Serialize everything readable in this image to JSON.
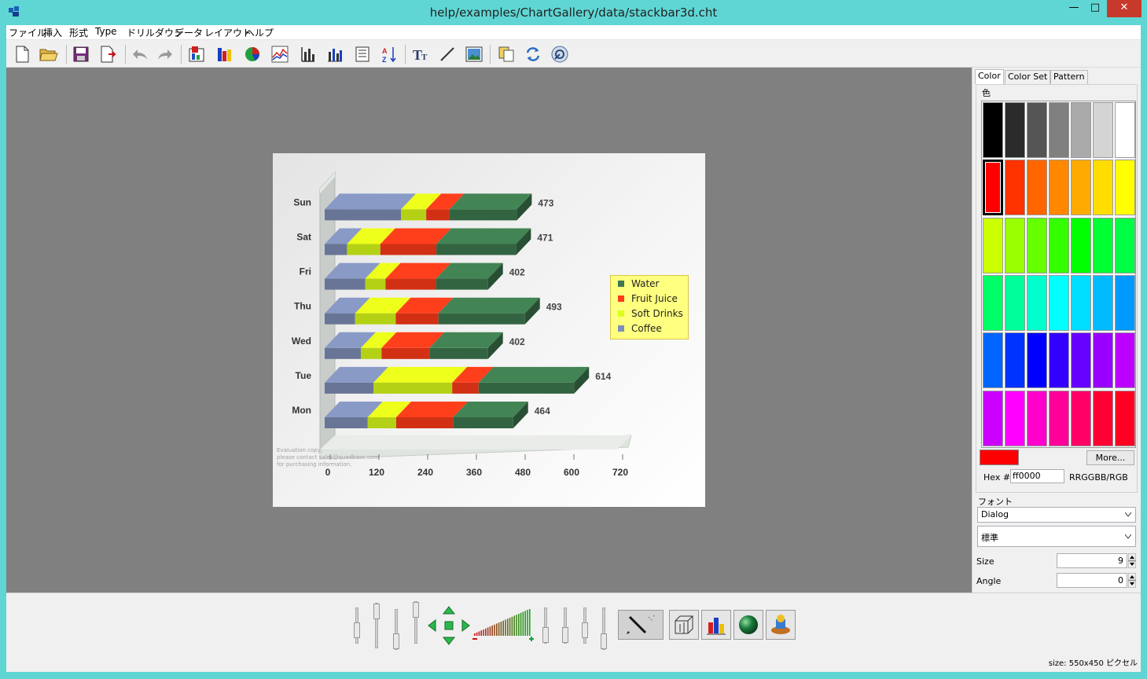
{
  "window": {
    "title": "help/examples/ChartGallery/data/stackbar3d.cht",
    "minimize": "—",
    "maximize": "□",
    "close": "✕"
  },
  "menu": [
    "ファイル",
    "挿入",
    "形式",
    "Type",
    "ドリルダウン",
    "データ",
    "レイアウト",
    "ヘルプ"
  ],
  "toolbar": {
    "icons": [
      "new-file-icon",
      "open-folder-icon",
      "save-icon",
      "export-icon",
      "undo-icon",
      "redo-icon",
      "chart-data-icon",
      "chart-type-icon",
      "pie-chart-icon",
      "line-chart-icon",
      "axis-icon",
      "bar-chart-icon",
      "table-icon",
      "sort-icon",
      "text-icon",
      "line-draw-icon",
      "image-icon",
      "copy-icon",
      "refresh-icon",
      "settings-icon"
    ]
  },
  "chart_data": {
    "type": "bar",
    "orientation": "horizontal",
    "stacked": true,
    "three_d": true,
    "categories": [
      "Mon",
      "Tue",
      "Wed",
      "Thu",
      "Fri",
      "Sat",
      "Sun"
    ],
    "series": [
      {
        "name": "Coffee",
        "color": "#7f8fb8",
        "values": [
          106,
          120,
          89,
          75,
          100,
          55,
          188
        ]
      },
      {
        "name": "Soft Drinks",
        "color": "#dcff1a",
        "values": [
          70,
          194,
          51,
          100,
          50,
          82,
          62
        ]
      },
      {
        "name": "Fruit Juice",
        "color": "#ff3a1a",
        "values": [
          140,
          65,
          118,
          105,
          124,
          138,
          57
        ]
      },
      {
        "name": "Water",
        "color": "#3e7a4f",
        "values": [
          148,
          235,
          144,
          213,
          128,
          196,
          166
        ]
      }
    ],
    "totals": [
      464,
      614,
      402,
      493,
      402,
      471,
      473
    ],
    "xticks": [
      0,
      120,
      240,
      360,
      480,
      600,
      720
    ],
    "xlim": [
      0,
      720
    ],
    "legend_position": "right",
    "watermark": [
      "Evaluation copy,",
      "please contact sales@quadbase.com",
      "for purchasing information."
    ]
  },
  "right_panel": {
    "tabs": [
      "Color",
      "Color Set",
      "Pattern"
    ],
    "color_label": "色",
    "swatch_columns": [
      [
        "#000000",
        "#ff0000",
        "#ccff00",
        "#00ff66",
        "#0066ff",
        "#cc00ff"
      ],
      [
        "#2b2b2b",
        "#ff3300",
        "#99ff00",
        "#00ff99",
        "#0033ff",
        "#ff00ff"
      ],
      [
        "#555555",
        "#ff6600",
        "#66ff00",
        "#00ffcc",
        "#0000ff",
        "#ff00cc"
      ],
      [
        "#808080",
        "#ff8800",
        "#33ff00",
        "#00ffff",
        "#3300ff",
        "#ff0099"
      ],
      [
        "#aaaaaa",
        "#ffaa00",
        "#00ff00",
        "#00ddff",
        "#6600ff",
        "#ff0066"
      ],
      [
        "#d4d4d4",
        "#ffdd00",
        "#00ff33",
        "#00bbff",
        "#9900ff",
        "#ff0033"
      ],
      [
        "#ffffff",
        "#ffff00",
        "#00ff44",
        "#0099ff",
        "#bb00ff",
        "#ff0022"
      ]
    ],
    "selected_color": "#ff0000",
    "more_label": "More...",
    "hex_label": "Hex #",
    "hex_value": "ff0000",
    "rgb_label": "RRGGBB/RGB",
    "font_label": "フォント",
    "font_family": "Dialog",
    "font_style": "標準",
    "size_label": "Size",
    "size_value": "9",
    "angle_label": "Angle",
    "angle_value": "0"
  },
  "status": {
    "size": "size: 550x450 ピクセル"
  }
}
